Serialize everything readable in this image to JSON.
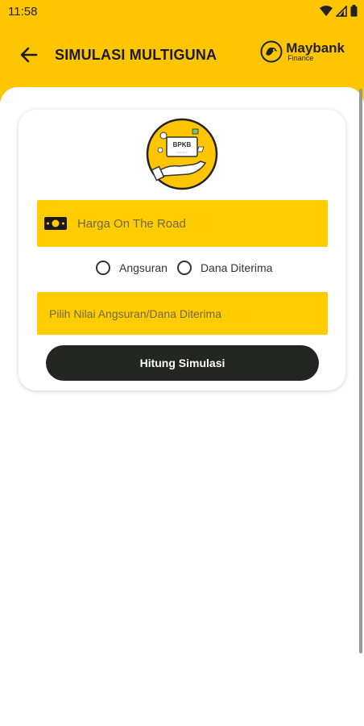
{
  "status_bar": {
    "time": "11:58"
  },
  "app_bar": {
    "title": "SIMULASI MULTIGUNA"
  },
  "brand": {
    "name": "Maybank",
    "sub": "Finance"
  },
  "illustration": {
    "doc_title": "BPKB",
    "doc_sub": "○ ○ ○ ○"
  },
  "form": {
    "price_placeholder": "Harga On The Road",
    "radio_options": [
      "Angsuran",
      "Dana Diterima"
    ],
    "value_placeholder": "Pilih Nilai Angsuran/Dana Diterima",
    "submit_label": "Hitung Simulasi"
  },
  "colors": {
    "primary": "#FFC600",
    "field": "#FFCC00",
    "button": "#222521"
  }
}
